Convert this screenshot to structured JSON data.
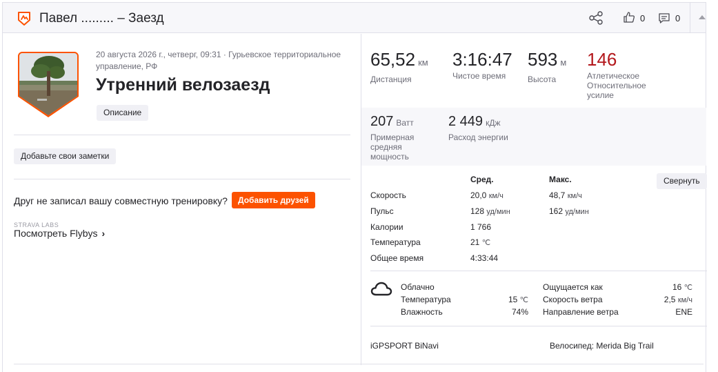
{
  "header": {
    "title": "Павел ......... – Заезд",
    "kudos_count": "0",
    "comments_count": "0",
    "logo_icon": "strava-run-shield-icon",
    "share_icon": "share-icon",
    "kudos_icon": "thumbs-up-icon",
    "comment_icon": "comment-icon",
    "collapse_icon": "caret-up-icon"
  },
  "activity": {
    "date_location": "20 августа 2026 г., четверг, 09:31 · Гурьевское территориальное управление, РФ",
    "title": "Утренний велозаезд",
    "description_button": "Описание",
    "notes_button": "Добавьте свои заметки",
    "friend_prompt": "Друг не записал вашу совместную тренировку?",
    "add_friends_button": "Добавить друзей",
    "labs_label": "STRAVA LABS",
    "flybys_link": "Посмотреть Flybys",
    "accent": "#fc5200"
  },
  "stats": {
    "distance": {
      "value": "65,52",
      "unit": "км",
      "label": "Дистанция"
    },
    "moving_time": {
      "value": "3:16:47",
      "label": "Чистое время"
    },
    "elevation": {
      "value": "593",
      "unit": "м",
      "label": "Высота"
    },
    "relative_effort": {
      "value": "146",
      "label": "Атлетическое Относительное усилие",
      "color": "#b3171b"
    },
    "power": {
      "value": "207",
      "unit": "Ватт",
      "label": "Примерная средняя мощность"
    },
    "energy": {
      "value": "2 449",
      "unit": "кДж",
      "label": "Расход энергии"
    }
  },
  "details": {
    "col_avg": "Сред.",
    "col_max": "Макс.",
    "collapse_button": "Свернуть",
    "rows": [
      {
        "label": "Скорость",
        "avg": "20,0",
        "avg_unit": "км/ч",
        "max": "48,7",
        "max_unit": "км/ч"
      },
      {
        "label": "Пульс",
        "avg": "128",
        "avg_unit": "уд/мин",
        "max": "162",
        "max_unit": "уд/мин"
      },
      {
        "label": "Калории",
        "avg": "1 766",
        "avg_unit": "",
        "max": "",
        "max_unit": ""
      },
      {
        "label": "Температура",
        "avg": "21",
        "avg_unit": "℃",
        "max": "",
        "max_unit": ""
      },
      {
        "label": "Общее время",
        "avg": "4:33:44",
        "avg_unit": "",
        "max": "",
        "max_unit": ""
      }
    ]
  },
  "weather": {
    "icon": "cloud-icon",
    "condition": "Облачно",
    "temp_label": "Температура",
    "temp_value": "15",
    "temp_unit": "℃",
    "humidity_label": "Влажность",
    "humidity_value": "74%",
    "feels_label": "Ощущается как",
    "feels_value": "16",
    "feels_unit": "℃",
    "wind_speed_label": "Скорость ветра",
    "wind_speed_value": "2,5",
    "wind_speed_unit": "км/ч",
    "wind_dir_label": "Направление ветра",
    "wind_dir_value": "ENE"
  },
  "gear": {
    "device": "iGPSPORT BiNavi",
    "bike_label": "Велосипед:",
    "bike_name": "Merida Big Trail"
  }
}
